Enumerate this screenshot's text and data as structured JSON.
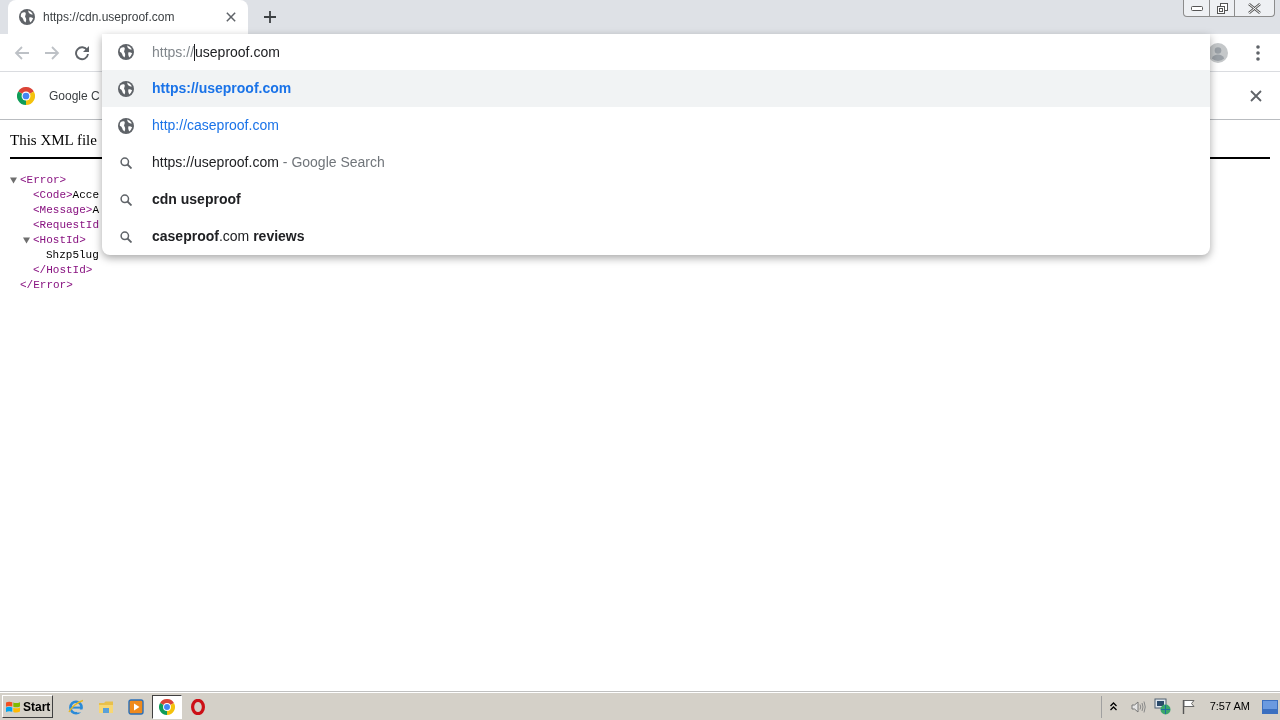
{
  "tabs": [
    {
      "title": "https://cdn.useproof.com",
      "selected": true
    }
  ],
  "toolbar": {
    "nav_buttons": [
      {
        "kind": "back",
        "disabled": true
      },
      {
        "kind": "forward",
        "disabled": true
      },
      {
        "kind": "reload",
        "disabled": false
      }
    ]
  },
  "omnibox": {
    "scheme": "https://",
    "host": "useproof.com",
    "suggestions": [
      {
        "kind": "url",
        "text": "https://useproof.com",
        "bold": true,
        "selected": true
      },
      {
        "kind": "url",
        "text": "http://caseproof.com",
        "bold": false,
        "selected": false
      },
      {
        "kind": "search",
        "text": "https://useproof.com",
        "description": "- Google Search",
        "bold": false,
        "selected": false
      },
      {
        "kind": "search",
        "text": "cdn useproof",
        "bold": true,
        "selected": false
      },
      {
        "kind": "search",
        "text": "**caseproof**.com **reviews**",
        "bold": false,
        "selected": false
      }
    ]
  },
  "infobar": {
    "text": "Google C"
  },
  "xml_viewer": {
    "notice": "This XML file",
    "tree": [
      {
        "kind": "branch",
        "open": "<Error>",
        "expanded": true,
        "close": "</Error>",
        "children": [
          {
            "kind": "leaf",
            "open": "<Code>",
            "text": "Acce"
          },
          {
            "kind": "leaf",
            "open": "<Message>",
            "text": "A"
          },
          {
            "kind": "leaf",
            "open": "<RequestId"
          },
          {
            "kind": "branch",
            "open": "<HostId>",
            "expanded": true,
            "close": "</HostId>",
            "children": [
              {
                "kind": "text",
                "text": "Shzp5lug"
              }
            ]
          }
        ]
      }
    ]
  },
  "taskbar": {
    "start": {
      "label": "Start"
    },
    "quick_launch": [
      {
        "kind": "ie",
        "selected": false
      },
      {
        "kind": "explorer",
        "selected": false
      },
      {
        "kind": "player",
        "selected": false
      },
      {
        "kind": "chrome",
        "selected": true
      },
      {
        "kind": "opera",
        "selected": false
      }
    ],
    "clock": "7:57 AM"
  }
}
